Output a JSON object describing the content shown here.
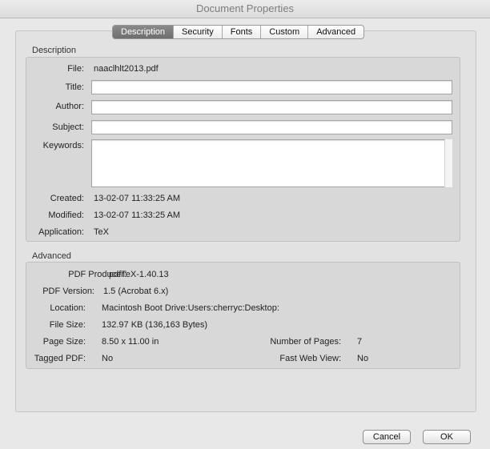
{
  "window": {
    "title": "Document Properties"
  },
  "tabs": [
    {
      "label": "Description"
    },
    {
      "label": "Security"
    },
    {
      "label": "Fonts"
    },
    {
      "label": "Custom"
    },
    {
      "label": "Advanced"
    }
  ],
  "description": {
    "section_title": "Description",
    "file_label": "File:",
    "file_value": "naaclhlt2013.pdf",
    "title_label": "Title:",
    "title_value": "",
    "author_label": "Author:",
    "author_value": "",
    "subject_label": "Subject:",
    "subject_value": "",
    "keywords_label": "Keywords:",
    "keywords_value": "",
    "created_label": "Created:",
    "created_value": "13-02-07 11:33:25 AM",
    "modified_label": "Modified:",
    "modified_value": "13-02-07 11:33:25 AM",
    "application_label": "Application:",
    "application_value": "TeX"
  },
  "advanced": {
    "section_title": "Advanced",
    "producer_label": "PDF Producer:",
    "producer_value": "pdfTeX-1.40.13",
    "version_label": "PDF Version:",
    "version_value": "1.5 (Acrobat 6.x)",
    "location_label": "Location:",
    "location_value": "Macintosh Boot Drive:Users:cherryc:Desktop:",
    "filesize_label": "File Size:",
    "filesize_value": "132.97 KB (136,163 Bytes)",
    "pagesize_label": "Page Size:",
    "pagesize_value": "8.50 x 11.00 in",
    "numpages_label": "Number of Pages:",
    "numpages_value": "7",
    "tagged_label": "Tagged PDF:",
    "tagged_value": "No",
    "fastweb_label": "Fast Web View:",
    "fastweb_value": "No"
  },
  "buttons": {
    "cancel": "Cancel",
    "ok": "OK"
  }
}
